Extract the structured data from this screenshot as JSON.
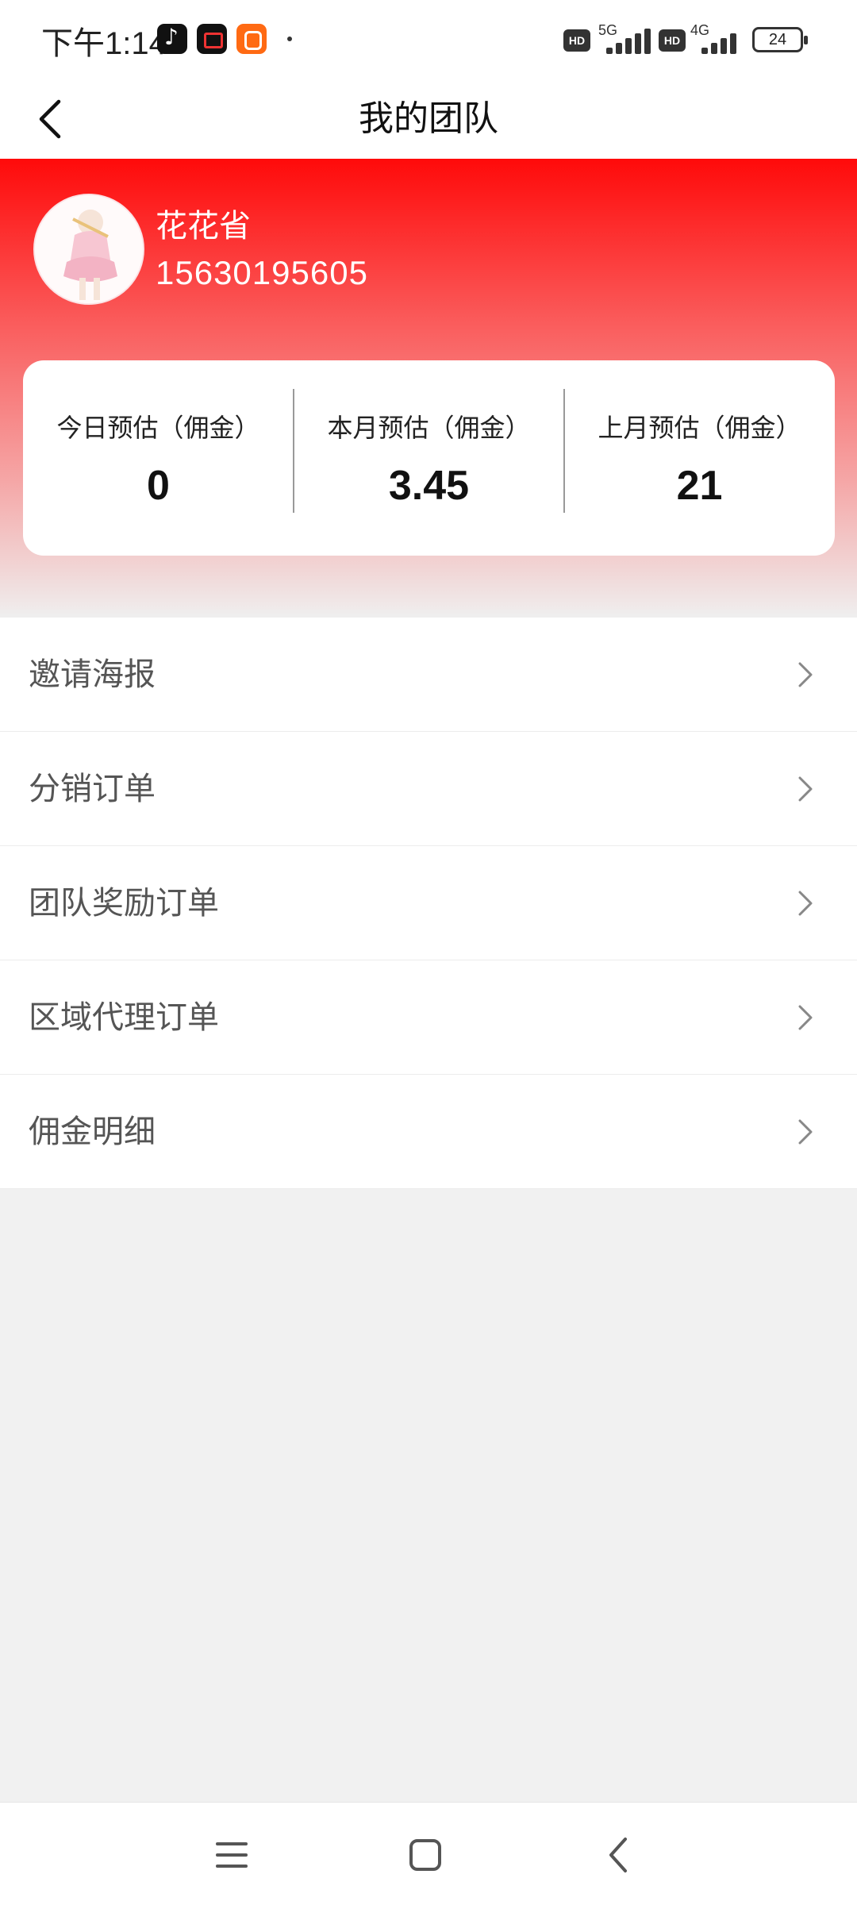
{
  "status_bar": {
    "time": "下午1:14",
    "hd1": "HD",
    "net1": "5G",
    "hd2": "HD",
    "net2": "4G",
    "battery": "24"
  },
  "nav": {
    "title": "我的团队"
  },
  "user": {
    "name": "花花省",
    "phone": "15630195605"
  },
  "stats": [
    {
      "label": "今日预估（佣金）",
      "value": "0"
    },
    {
      "label": "本月预估（佣金）",
      "value": "3.45"
    },
    {
      "label": "上月预估（佣金）",
      "value": "21"
    }
  ],
  "menu": [
    {
      "label": "邀请海报"
    },
    {
      "label": "分销订单"
    },
    {
      "label": "团队奖励订单"
    },
    {
      "label": "区域代理订单"
    },
    {
      "label": "佣金明细"
    }
  ],
  "icons": {
    "back": "chevron-left-icon",
    "row": "chevron-right-icon",
    "sys_menu": "menu-icon",
    "sys_home": "home-icon",
    "sys_back": "back-icon"
  },
  "colors": {
    "header_top": "#ff0a0a",
    "background": "#f1f1f1"
  }
}
